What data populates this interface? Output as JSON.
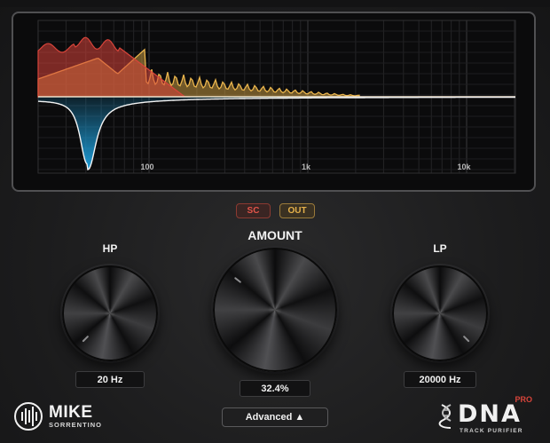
{
  "display": {
    "freq_labels": [
      "100",
      "1k",
      "10k"
    ],
    "colors": {
      "sc": "#d8443a",
      "out": "#e9b44c",
      "cut": "#1d9bd6",
      "zero_line": "#f0e0c8"
    }
  },
  "buttons": {
    "sc_label": "SC",
    "out_label": "OUT",
    "advanced_label": "Advanced ▲"
  },
  "controls": {
    "hp": {
      "label": "HP",
      "value": "20 Hz"
    },
    "amount": {
      "label": "AMOUNT",
      "value": "32.4%"
    },
    "lp": {
      "label": "LP",
      "value": "20000 Hz"
    }
  },
  "branding": {
    "left_name": "MIKE",
    "left_sub": "SORRENTINO",
    "right_name": "DNA",
    "right_badge": "PRO",
    "right_sub": "TRACK PURIFIER"
  },
  "icons": {
    "left_logo": "waveform-logo-icon",
    "right_logo": "dna-helix-icon",
    "advanced_arrow": "triangle-up-icon"
  }
}
